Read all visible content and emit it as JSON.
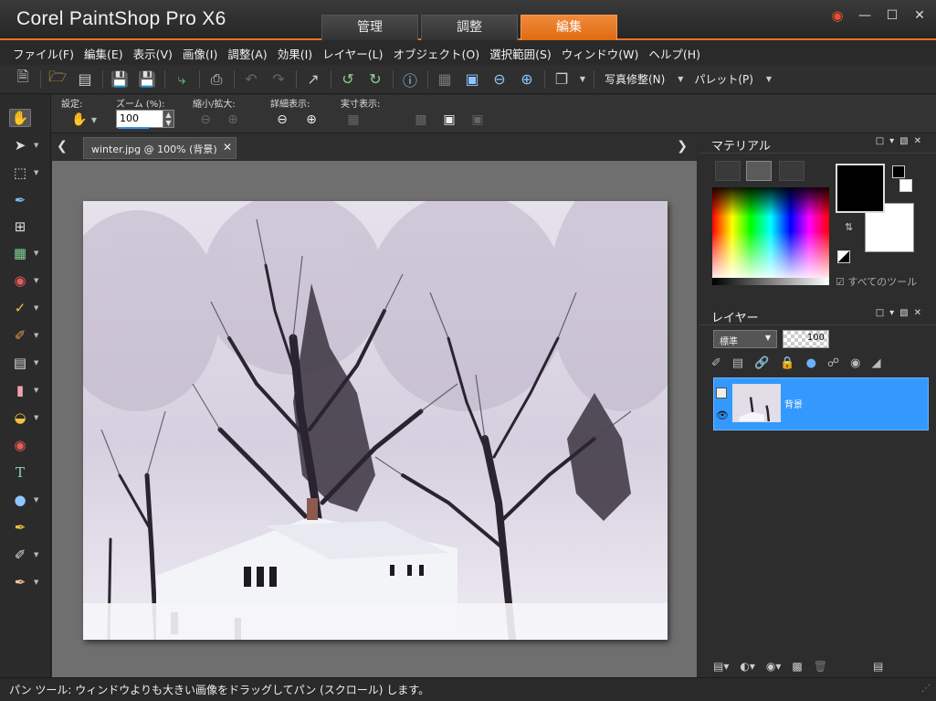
{
  "app": {
    "title": "Corel PaintShop Pro X6"
  },
  "workspace_tabs": [
    {
      "label": "管理"
    },
    {
      "label": "調整"
    },
    {
      "label": "編集"
    }
  ],
  "menu": [
    {
      "label": "ファイル(F)"
    },
    {
      "label": "編集(E)"
    },
    {
      "label": "表示(V)"
    },
    {
      "label": "画像(I)"
    },
    {
      "label": "調整(A)"
    },
    {
      "label": "効果(I)"
    },
    {
      "label": "レイヤー(L)"
    },
    {
      "label": "オブジェクト(O)"
    },
    {
      "label": "選択範囲(S)"
    },
    {
      "label": "ウィンドウ(W)"
    },
    {
      "label": "ヘルプ(H)"
    }
  ],
  "toolbar": {
    "photo_fix_label": "写真修整(N)",
    "palette_label": "パレット(P)"
  },
  "options": {
    "preset_label": "設定:",
    "zoom_label": "ズーム (%):",
    "zoom_value": "100",
    "zoom_inout_label": "縮小/拡大:",
    "detail_label": "詳細表示:",
    "actual_label": "実寸表示:"
  },
  "document": {
    "tab_label": "winter.jpg @ 100% (背景)"
  },
  "materials": {
    "title": "マテリアル",
    "all_tools_label": "すべてのツール",
    "fg_color": "#000000",
    "bg_color": "#ffffff"
  },
  "layers": {
    "title": "レイヤー",
    "blend_mode": "標準",
    "opacity": "100",
    "items": [
      {
        "name": "背景"
      }
    ]
  },
  "status": {
    "text": "パン ツール: ウィンドウよりも大きい画像をドラッグしてパン (スクロール) します。"
  },
  "colors": {
    "accent": "#e8731e",
    "selection": "#3399ff"
  }
}
